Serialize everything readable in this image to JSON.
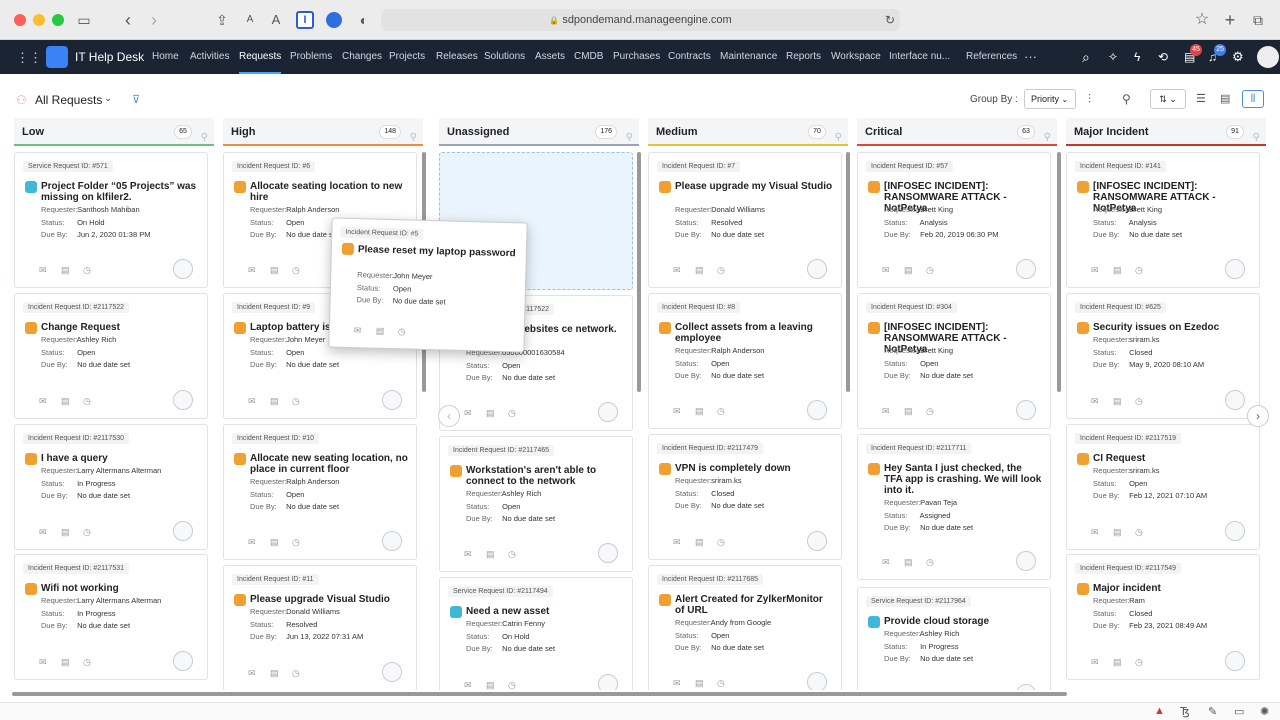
{
  "browser": {
    "url": "sdpondemand.manageengine.com",
    "lock": "🔒"
  },
  "app": {
    "name": "IT Help Desk"
  },
  "nav": [
    "Home",
    "Activities",
    "Requests",
    "Problems",
    "Changes",
    "Projects",
    "Releases",
    "Solutions",
    "Assets",
    "CMDB",
    "Purchases",
    "Contracts",
    "Maintenance",
    "Reports",
    "Workspace",
    "Interface nu...",
    "References"
  ],
  "nav_more": "···",
  "badges": {
    "tasks": "45",
    "notifications": "25"
  },
  "toolbar": {
    "view": "All Requests",
    "group_by_label": "Group By :",
    "group_by_value": "Priority"
  },
  "columns": [
    {
      "name": "Low",
      "count": "65",
      "color": "#6ac27e",
      "cards": [
        {
          "id": "Service Request ID: #571",
          "type": "srv",
          "title": "Project Folder “05 Projects” was missing on klfiler2.",
          "requester": "Santhosh Mahiban",
          "status": "On Hold",
          "due": "Jun 2, 2020 01:38 PM",
          "lines": 2
        },
        {
          "id": "Incident Request ID: #2117522",
          "type": "inc",
          "title": "Change Request",
          "requester": "Ashley Rich",
          "status": "Open",
          "due": "No due date set",
          "lines": 1
        },
        {
          "id": "Incident Request ID: #2117530",
          "type": "inc",
          "title": "I have a query",
          "requester": "Larry Altermans Alterman",
          "status": "In Progress",
          "due": "No due date set",
          "lines": 1
        },
        {
          "id": "Incident Request ID: #2117531",
          "type": "inc",
          "title": "Wifi not working",
          "requester": "Larry Altermans Alterman",
          "status": "In Progress",
          "due": "No due date set",
          "lines": 1
        }
      ]
    },
    {
      "name": "High",
      "count": "148",
      "color": "#f08c3a",
      "cards": [
        {
          "id": "Incident Request ID: #6",
          "type": "inc",
          "title": "Allocate seating location to new hire",
          "requester": "Ralph Anderson",
          "status": "Open",
          "due": "No due date set",
          "lines": 2
        },
        {
          "id": "Incident Request ID: #9",
          "type": "inc",
          "title": "Laptop battery is",
          "requester": "John Meyer",
          "status": "Open",
          "due": "No due date set",
          "lines": 1
        },
        {
          "id": "Incident Request ID: #10",
          "type": "inc",
          "title": "Allocate new seating location, no place in current floor",
          "requester": "Ralph Anderson",
          "status": "Open",
          "due": "No due date set",
          "lines": 2
        },
        {
          "id": "Incident Request ID: #11",
          "type": "inc",
          "title": "Please upgrade Visual Studio",
          "requester": "Donald Williams",
          "status": "Resolved",
          "due": "Jun 13, 2022 07:31 AM",
          "lines": 1
        }
      ]
    },
    {
      "name": "Unassigned",
      "count": "176",
      "color": "#9aa4b2",
      "cards": [
        {
          "id": "Incident Request ID: #2117522",
          "type": "inc",
          "title": "ccess any websites ce network.",
          "requester": "050000001630584",
          "status": "Open",
          "due": "No due date set",
          "lines": 2
        },
        {
          "id": "Incident Request ID: #2117465",
          "type": "inc",
          "title": "Workstation's aren't able to connect to the network",
          "requester": "Ashley Rich",
          "status": "Open",
          "due": "No due date set",
          "lines": 2
        },
        {
          "id": "Service Request ID: #2117494",
          "type": "srv",
          "title": "Need a new asset",
          "requester": "Catrin Fenny",
          "status": "On Hold",
          "due": "No due date set",
          "lines": 1
        }
      ]
    },
    {
      "name": "Medium",
      "count": "70",
      "color": "#e9c23a",
      "cards": [
        {
          "id": "Incident Request ID: #7",
          "type": "inc",
          "title": "Please upgrade my Visual Studio",
          "requester": "Donald Williams",
          "status": "Resolved",
          "due": "No due date set",
          "lines": 2
        },
        {
          "id": "Incident Request ID: #8",
          "type": "inc",
          "title": "Collect assets from a leaving employee",
          "requester": "Ralph Anderson",
          "status": "Open",
          "due": "No due date set",
          "lines": 2
        },
        {
          "id": "Incident Request ID: #2117479",
          "type": "inc",
          "title": "VPN is completely down",
          "requester": "sriram.ks",
          "status": "Closed",
          "due": "No due date set",
          "lines": 1
        },
        {
          "id": "Incident Request ID: #2117685",
          "type": "inc",
          "title": "Alert Created for ZylkerMonitor of URL",
          "requester": "Andy from Google",
          "status": "Open",
          "due": "No due date set",
          "lines": 2
        }
      ]
    },
    {
      "name": "Critical",
      "count": "63",
      "color": "#e0463a",
      "cards": [
        {
          "id": "Incident Request ID: #57",
          "type": "inc",
          "title": "[INFOSEC INCIDENT]: RANSOMWARE ATTACK - NotPetya",
          "requester": "Brett King",
          "status": "Analysis",
          "due": "Feb 20, 2019 06:30 PM",
          "lines": 2
        },
        {
          "id": "Incident Request ID: #304",
          "type": "inc",
          "title": "[INFOSEC INCIDENT]: RANSOMWARE ATTACK - NotPetya",
          "requester": "Brett King",
          "status": "Open",
          "due": "No due date set",
          "lines": 2
        },
        {
          "id": "Incident Request ID: #2117711",
          "type": "inc",
          "title": "Hey Santa I just checked, the TFA app is crashing. We will look into it.",
          "requester": "Pavan Teja",
          "status": "Assigned",
          "due": "No due date set",
          "lines": 3
        },
        {
          "id": "Service Request ID: #2117964",
          "type": "srv",
          "title": "Provide cloud storage",
          "requester": "Ashley Rich",
          "status": "In Progress",
          "due": "No due date set",
          "lines": 1
        }
      ]
    },
    {
      "name": "Major Incident",
      "count": "91",
      "color": "#c0392b",
      "cards": [
        {
          "id": "Incident Request ID: #141",
          "type": "inc",
          "title": "[INFOSEC INCIDENT]: RANSOMWARE ATTACK - NotPetya",
          "requester": "Brett King",
          "status": "Analysis",
          "due": "No due date set",
          "lines": 2
        },
        {
          "id": "Incident Request ID: #625",
          "type": "inc",
          "title": "Security issues on Ezedoc",
          "requester": "sriram.ks",
          "status": "Closed",
          "due": "May 9, 2020 08:10 AM",
          "lines": 1
        },
        {
          "id": "Incident Request ID: #2117519",
          "type": "inc",
          "title": "CI Request",
          "requester": "sriram.ks",
          "status": "Open",
          "due": "Feb 12, 2021 07:10 AM",
          "lines": 1
        },
        {
          "id": "Incident Request ID: #2117549",
          "type": "inc",
          "title": "Major incident",
          "requester": "Ram",
          "status": "Closed",
          "due": "Feb 23, 2021 08:49 AM",
          "lines": 1
        }
      ]
    }
  ],
  "dragged": {
    "id": "Incident Request ID: #5",
    "title": "Please reset my laptop password",
    "requester": "John Meyer",
    "status": "Open",
    "due": "No due date set"
  },
  "labels": {
    "requester": "Requester:",
    "status": "Status:",
    "due": "Due By:"
  }
}
